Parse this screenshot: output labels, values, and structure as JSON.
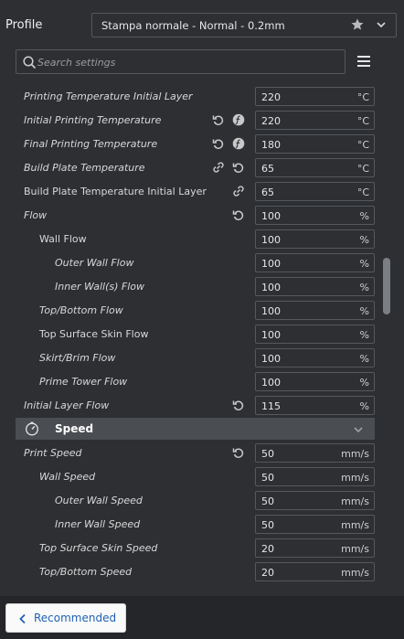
{
  "header": {
    "profile_label": "Profile",
    "profile_value": "Stampa normale - Normal - 0.2mm"
  },
  "search": {
    "placeholder": "Search settings"
  },
  "settings": [
    {
      "label": "Printing Temperature Initial Layer",
      "value": "220",
      "unit": "°C"
    },
    {
      "label": "Initial Printing Temperature",
      "value": "220",
      "unit": "°C"
    },
    {
      "label": "Final Printing Temperature",
      "value": "180",
      "unit": "°C"
    },
    {
      "label": "Build Plate Temperature",
      "value": "65",
      "unit": "°C"
    },
    {
      "label": "Build Plate Temperature Initial Layer",
      "value": "65",
      "unit": "°C"
    },
    {
      "label": "Flow",
      "value": "100",
      "unit": "%"
    },
    {
      "label": "Wall Flow",
      "value": "100",
      "unit": "%"
    },
    {
      "label": "Outer Wall Flow",
      "value": "100",
      "unit": "%"
    },
    {
      "label": "Inner Wall(s) Flow",
      "value": "100",
      "unit": "%"
    },
    {
      "label": "Top/Bottom Flow",
      "value": "100",
      "unit": "%"
    },
    {
      "label": "Top Surface Skin Flow",
      "value": "100",
      "unit": "%"
    },
    {
      "label": "Skirt/Brim Flow",
      "value": "100",
      "unit": "%"
    },
    {
      "label": "Prime Tower Flow",
      "value": "100",
      "unit": "%"
    },
    {
      "label": "Initial Layer Flow",
      "value": "115",
      "unit": "%"
    }
  ],
  "speed_category": {
    "title": "Speed"
  },
  "speed_settings": [
    {
      "label": "Print Speed",
      "value": "50",
      "unit": "mm/s"
    },
    {
      "label": "Wall Speed",
      "value": "50",
      "unit": "mm/s"
    },
    {
      "label": "Outer Wall Speed",
      "value": "50",
      "unit": "mm/s"
    },
    {
      "label": "Inner Wall Speed",
      "value": "50",
      "unit": "mm/s"
    },
    {
      "label": "Top Surface Skin Speed",
      "value": "20",
      "unit": "mm/s"
    },
    {
      "label": "Top/Bottom Speed",
      "value": "20",
      "unit": "mm/s"
    }
  ],
  "footer": {
    "recommended_label": "Recommended"
  }
}
